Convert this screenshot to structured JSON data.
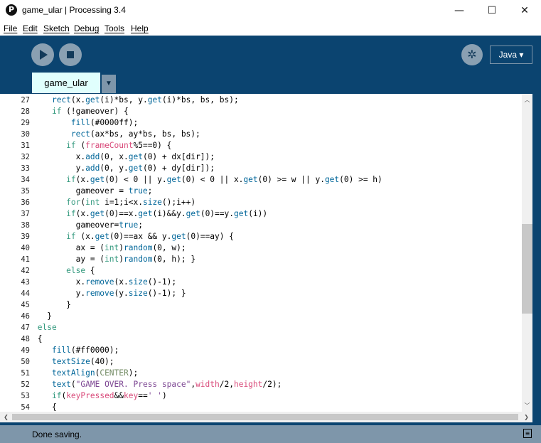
{
  "window": {
    "title": "game_ular | Processing 3.4",
    "app_icon_glyph": "P",
    "minimize_glyph": "—",
    "maximize_glyph": "☐",
    "close_glyph": "✕"
  },
  "menu": {
    "items": [
      {
        "label": "File"
      },
      {
        "label": "Edit"
      },
      {
        "label": "Sketch"
      },
      {
        "label": "Debug"
      },
      {
        "label": "Tools"
      },
      {
        "label": "Help"
      }
    ]
  },
  "toolbar": {
    "debug_glyph": "✲",
    "mode_label": "Java ▾"
  },
  "tabs": {
    "active_label": "game_ular",
    "menu_glyph": "▼"
  },
  "editor": {
    "line_numbers": [
      "27",
      "28",
      "29",
      "30",
      "31",
      "32",
      "33",
      "34",
      "35",
      "36",
      "37",
      "38",
      "39",
      "40",
      "41",
      "42",
      "43",
      "44",
      "45",
      "46",
      "47",
      "48",
      "49",
      "50",
      "51",
      "52",
      "53",
      "54"
    ],
    "scroll_up_glyph": "︿",
    "scroll_down_glyph": "﹀",
    "scroll_left_glyph": "❮",
    "scroll_right_glyph": "❯"
  },
  "status": {
    "message": "Done saving.",
    "icon": "console-icon"
  },
  "colors": {
    "toolbar_bg": "#0b4470",
    "status_bg": "#7e96aa",
    "tab_active_bg": "#e0fffd",
    "keyword": "#33997e",
    "function": "#006699",
    "literal": "#7d4793",
    "constant": "#718a62"
  },
  "code": {
    "l27": [
      "    ",
      "rect",
      "(x.",
      "get",
      "(i)*bs, y.",
      "get",
      "(i)*bs, bs, bs);"
    ],
    "l28": [
      "    ",
      "if",
      " (!gameover) {"
    ],
    "l29": [
      "        ",
      "fill",
      "(#0000ff);"
    ],
    "l30": [
      "        ",
      "rect",
      "(ax*bs, ay*bs, bs, bs);"
    ],
    "l31": [
      "       ",
      "if",
      " (",
      "frameCount",
      "%5==0) {"
    ],
    "l32": [
      "         x.",
      "add",
      "(0, x.",
      "get",
      "(0) + dx[dir]);"
    ],
    "l33": [
      "         y.",
      "add",
      "(0, y.",
      "get",
      "(0) + dy[dir]);"
    ],
    "l34": [
      "       ",
      "if",
      "(x.",
      "get",
      "(0) < 0 || y.",
      "get",
      "(0) < 0 || x.",
      "get",
      "(0) >= w || y.",
      "get",
      "(0) >= h)"
    ],
    "l35": [
      "         gameover = ",
      "true",
      ";"
    ],
    "l36": [
      "       ",
      "for",
      "(",
      "int",
      " i=1;i<x.",
      "size",
      "();i++)"
    ],
    "l37": [
      "       ",
      "if",
      "(x.",
      "get",
      "(0)==x.",
      "get",
      "(i)&&y.",
      "get",
      "(0)==y.",
      "get",
      "(i))"
    ],
    "l38": [
      "         gameover=",
      "true",
      ";"
    ],
    "l39": [
      "       ",
      "if",
      " (x.",
      "get",
      "(0)==ax && y.",
      "get",
      "(0)==ay) {"
    ],
    "l40": [
      "         ax = (",
      "int",
      ")",
      "random",
      "(0, w);"
    ],
    "l41": [
      "         ay = (",
      "int",
      ")",
      "random",
      "(0, h); }"
    ],
    "l42": [
      "       ",
      "else",
      " {"
    ],
    "l43": [
      "         x.",
      "remove",
      "(x.",
      "size",
      "()-1);"
    ],
    "l44": [
      "         y.",
      "remove",
      "(y.",
      "size",
      "()-1); }"
    ],
    "l45": [
      "       }"
    ],
    "l46": [
      "   }"
    ],
    "l47": [
      " ",
      "else"
    ],
    "l48": [
      " {"
    ],
    "l49": [
      "    ",
      "fill",
      "(#ff0000);"
    ],
    "l50": [
      "    ",
      "textSize",
      "(40);"
    ],
    "l51": [
      "    ",
      "textAlign",
      "(",
      "CENTER",
      ");"
    ],
    "l52": [
      "    ",
      "text",
      "(",
      "\"GAME OVER. Press space\"",
      ",",
      "width",
      "/2,",
      "height",
      "/2);"
    ],
    "l53": [
      "    ",
      "if",
      "(",
      "keyPressed",
      "&&",
      "key",
      "==",
      "' '",
      ")"
    ],
    "l54": [
      "    {"
    ]
  }
}
